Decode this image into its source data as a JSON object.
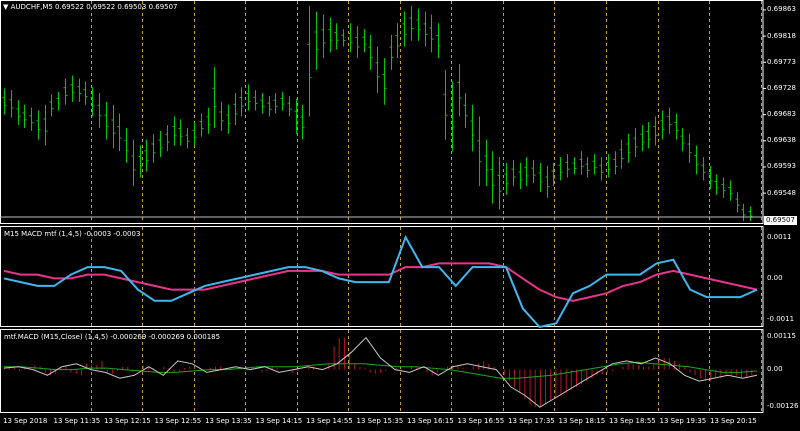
{
  "main_panel": {
    "title_arrow": "▼",
    "title": "AUDCHF,M5  0.69522 0.69522 0.69503 0.69507",
    "price_ticks": [
      "0.69863",
      "0.69818",
      "0.69773",
      "0.69728",
      "0.69683",
      "0.69638",
      "0.69593",
      "0.69548"
    ],
    "current_price": "0.69507",
    "current_price_value": 0.69507,
    "y_range": [
      0.69495,
      0.6988
    ],
    "candle_color": "#00c800",
    "candles_hl": [
      [
        0.69728,
        0.69683
      ],
      [
        0.69725,
        0.69678
      ],
      [
        0.69708,
        0.69665
      ],
      [
        0.697,
        0.6966
      ],
      [
        0.69695,
        0.69655
      ],
      [
        0.6969,
        0.6964
      ],
      [
        0.697,
        0.6963
      ],
      [
        0.69718,
        0.6968
      ],
      [
        0.69722,
        0.6969
      ],
      [
        0.69745,
        0.697
      ],
      [
        0.6975,
        0.69705
      ],
      [
        0.69745,
        0.69705
      ],
      [
        0.6974,
        0.697
      ],
      [
        0.6973,
        0.6968
      ],
      [
        0.6972,
        0.6966
      ],
      [
        0.69705,
        0.6964
      ],
      [
        0.697,
        0.69625
      ],
      [
        0.69685,
        0.6962
      ],
      [
        0.6966,
        0.696
      ],
      [
        0.6964,
        0.6956
      ],
      [
        0.6963,
        0.69575
      ],
      [
        0.6964,
        0.69585
      ],
      [
        0.6965,
        0.696
      ],
      [
        0.69655,
        0.6961
      ],
      [
        0.69665,
        0.6962
      ],
      [
        0.6968,
        0.6963
      ],
      [
        0.69675,
        0.6963
      ],
      [
        0.6966,
        0.69625
      ],
      [
        0.6967,
        0.6963
      ],
      [
        0.69685,
        0.69645
      ],
      [
        0.69695,
        0.6965
      ],
      [
        0.69765,
        0.6966
      ],
      [
        0.69705,
        0.69655
      ],
      [
        0.697,
        0.6965
      ],
      [
        0.6972,
        0.69665
      ],
      [
        0.6973,
        0.6968
      ],
      [
        0.69735,
        0.6969
      ],
      [
        0.69725,
        0.6969
      ],
      [
        0.6972,
        0.69685
      ],
      [
        0.69715,
        0.6968
      ],
      [
        0.6972,
        0.69685
      ],
      [
        0.69722,
        0.6969
      ],
      [
        0.69715,
        0.6968
      ],
      [
        0.6971,
        0.6965
      ],
      [
        0.697,
        0.6964
      ],
      [
        0.6987,
        0.6968
      ],
      [
        0.6986,
        0.6976
      ],
      [
        0.69855,
        0.6978
      ],
      [
        0.6985,
        0.6979
      ],
      [
        0.6984,
        0.69795
      ],
      [
        0.6983,
        0.698
      ],
      [
        0.6984,
        0.6979
      ],
      [
        0.69835,
        0.6978
      ],
      [
        0.6983,
        0.6979
      ],
      [
        0.6982,
        0.6976
      ],
      [
        0.698,
        0.6972
      ],
      [
        0.6978,
        0.697
      ],
      [
        0.6982,
        0.6976
      ],
      [
        0.6984,
        0.6978
      ],
      [
        0.6986,
        0.698
      ],
      [
        0.6987,
        0.6981
      ],
      [
        0.69865,
        0.6981
      ],
      [
        0.6986,
        0.698
      ],
      [
        0.69855,
        0.6979
      ],
      [
        0.6984,
        0.6978
      ],
      [
        0.6976,
        0.6964
      ],
      [
        0.6974,
        0.6962
      ],
      [
        0.6977,
        0.6968
      ],
      [
        0.6972,
        0.6966
      ],
      [
        0.697,
        0.6962
      ],
      [
        0.6968,
        0.6956
      ],
      [
        0.6964,
        0.6956
      ],
      [
        0.6962,
        0.6953
      ],
      [
        0.6961,
        0.6952
      ],
      [
        0.696,
        0.69545
      ],
      [
        0.69605,
        0.6956
      ],
      [
        0.696,
        0.69555
      ],
      [
        0.6961,
        0.6956
      ],
      [
        0.69605,
        0.69565
      ],
      [
        0.696,
        0.6955
      ],
      [
        0.69595,
        0.6954
      ],
      [
        0.696,
        0.6956
      ],
      [
        0.6961,
        0.6957
      ],
      [
        0.69615,
        0.69575
      ],
      [
        0.6961,
        0.6958
      ],
      [
        0.6962,
        0.6958
      ],
      [
        0.6961,
        0.69575
      ],
      [
        0.69615,
        0.6958
      ],
      [
        0.6961,
        0.6957
      ],
      [
        0.69615,
        0.69575
      ],
      [
        0.6962,
        0.6958
      ],
      [
        0.6964,
        0.6959
      ],
      [
        0.6965,
        0.696
      ],
      [
        0.6966,
        0.6961
      ],
      [
        0.69665,
        0.6962
      ],
      [
        0.6967,
        0.69625
      ],
      [
        0.6968,
        0.6963
      ],
      [
        0.6969,
        0.6964
      ],
      [
        0.69695,
        0.6965
      ],
      [
        0.69685,
        0.6964
      ],
      [
        0.6966,
        0.6962
      ],
      [
        0.6965,
        0.696
      ],
      [
        0.6963,
        0.6958
      ],
      [
        0.6961,
        0.6957
      ],
      [
        0.69595,
        0.69555
      ],
      [
        0.6958,
        0.69545
      ],
      [
        0.69575,
        0.6954
      ],
      [
        0.6957,
        0.69535
      ],
      [
        0.6955,
        0.69515
      ],
      [
        0.6953,
        0.695
      ],
      [
        0.69525,
        0.695
      ]
    ]
  },
  "macd_panel": {
    "title": "M15 MACD mtf (1,4,5) -0.0003 -0.0003",
    "ticks": [
      "0.0011",
      "0.00",
      "-0.0011"
    ],
    "y_range": [
      -0.0013,
      0.0014
    ],
    "macd_color": "#3fb8f0",
    "signal_color": "#e8358c",
    "macd_line": [
      0.0,
      -0.0001,
      -0.0002,
      -0.0002,
      0.0001,
      0.0003,
      0.0003,
      0.0002,
      -0.0003,
      -0.0006,
      -0.0006,
      -0.0004,
      -0.0002,
      -0.0001,
      0.0,
      0.0001,
      0.0002,
      0.0003,
      0.0003,
      0.0002,
      0.0,
      -0.0001,
      -0.0001,
      -0.0001,
      0.0011,
      0.0003,
      0.0003,
      -0.0002,
      0.0003,
      0.0003,
      0.0003,
      -0.0008,
      -0.0013,
      -0.0012,
      -0.0004,
      -0.0002,
      0.0001,
      0.0001,
      0.0001,
      0.0004,
      0.0005,
      -0.0003,
      -0.0005,
      -0.0005,
      -0.0005,
      -0.0003
    ],
    "signal_line": [
      0.0002,
      0.0001,
      0.0001,
      0.0,
      0.0,
      0.0001,
      0.0001,
      0.0,
      -0.0001,
      -0.0002,
      -0.0003,
      -0.0003,
      -0.0003,
      -0.0002,
      -0.0001,
      0.0,
      0.0001,
      0.0002,
      0.0002,
      0.0002,
      0.0001,
      0.0001,
      0.0001,
      0.0001,
      0.0003,
      0.0003,
      0.0004,
      0.0004,
      0.0004,
      0.0004,
      0.0003,
      0.0,
      -0.0003,
      -0.0005,
      -0.0006,
      -0.0005,
      -0.0004,
      -0.0002,
      -0.0001,
      0.0001,
      0.0002,
      0.0001,
      0.0,
      -0.0001,
      -0.0002,
      -0.0003
    ]
  },
  "mtf_panel": {
    "title": "mtf.MACD (M15,Close) (1,4,5) -0.000269 -0.000269 0.000185",
    "ticks": [
      "0.00115",
      "0.00",
      "-0.00126"
    ],
    "y_range": [
      -0.0015,
      0.0014
    ],
    "hist_color": "#c0102a",
    "line1_color": "#c8c8c8",
    "line2_color": "#1aaa1a",
    "histogram": [
      5e-05,
      8e-05,
      0.0001,
      -5e-05,
      3e-05,
      0.0001,
      0.00015,
      0.0001,
      -0.0001,
      -0.0002,
      -0.00015,
      5e-05,
      0.0001,
      -0.0001,
      -0.00015,
      -0.0002,
      0.0002,
      0.0002,
      0.00015,
      0.0003,
      -0.0001,
      -0.00015,
      -5e-05,
      0.0001,
      0.0001,
      -0.0001,
      0.0,
      0.00015,
      0.0001,
      5e-05,
      0.0,
      0.0001,
      5e-05,
      -0.0001,
      -5e-05,
      5e-05,
      0.0001,
      0.0001,
      5e-05,
      0.0,
      5e-05,
      0.0001,
      0.0001,
      5e-05,
      0.0,
      0.0,
      5e-05,
      0.0001,
      5e-05,
      0.0,
      -0.0001,
      -5e-05,
      0.0001,
      5e-05,
      0.0,
      0.0,
      -0.0001,
      -5e-05,
      0.0,
      5e-05,
      0.0001,
      5e-05,
      0.0,
      0.0002,
      0.0008,
      0.0011,
      0.0011,
      0.0006,
      0.0002,
      0.0001,
      5e-05,
      -0.0001,
      -0.00015,
      -0.0001,
      -5e-05,
      0.0,
      5e-05,
      -5e-05,
      0.0,
      0.0001,
      5e-05,
      0.0,
      -0.0001,
      -0.0002,
      -0.0001,
      0.0,
      0.0001,
      0.00015,
      0.0001,
      5e-05,
      0.0,
      0.0001,
      0.0002,
      0.0003,
      0.0002,
      0.0001,
      0.0,
      -0.0002,
      -0.0004,
      -0.0006,
      -0.0008,
      -0.001,
      -0.0012,
      -0.0013,
      -0.0013,
      -0.0012,
      -0.0011,
      -0.001,
      -0.0009,
      -0.0008,
      -0.0007,
      -0.0006,
      -0.0005,
      -0.0004,
      -0.0003,
      -0.0002,
      -0.00015,
      -0.0001,
      -5e-05,
      0.0,
      0.0001,
      0.0002,
      0.0002,
      0.00015,
      0.0001,
      0.0001,
      0.0002,
      0.0003,
      0.0004,
      0.0004,
      0.0003,
      0.0002,
      0.0001,
      -0.0001,
      -0.0002,
      -0.0003,
      -0.0004,
      -0.0004,
      -0.0003,
      -0.0003,
      -0.0002,
      -0.0002,
      -0.0002,
      -0.0003,
      -0.0003,
      -0.0002
    ],
    "line1": [
      5e-05,
      0.0001,
      0.0,
      -0.0002,
      0.0001,
      0.0002,
      0.0,
      -0.0001,
      -0.0003,
      -0.0002,
      0.0001,
      -0.0002,
      0.0003,
      0.0002,
      -0.0001,
      0.0,
      0.0001,
      0.0,
      0.0001,
      -0.0001,
      0.0,
      0.0001,
      0.0,
      0.0002,
      0.0006,
      0.0011,
      0.0004,
      0.0,
      -0.0001,
      0.0001,
      -0.0002,
      0.0001,
      0.0002,
      0.0001,
      0.0,
      -0.0006,
      -0.0009,
      -0.0013,
      -0.001,
      -0.0007,
      -0.0004,
      -0.0001,
      0.0002,
      0.0003,
      0.0002,
      0.0004,
      0.0002,
      -0.0002,
      -0.0004,
      -0.0003,
      -0.0002,
      -0.0003,
      -0.0002
    ],
    "line2": [
      0.0001,
      0.0001,
      5e-05,
      0.0,
      0.0,
      5e-05,
      5e-05,
      0.0,
      -5e-05,
      -0.0001,
      -0.0001,
      -5e-05,
      0.0,
      0.0,
      5e-05,
      0.0001,
      0.0001,
      0.0001,
      0.00015,
      0.0002,
      0.0002,
      0.0002,
      0.00015,
      0.0001,
      0.0001,
      5e-05,
      0.0,
      -0.0001,
      -0.0002,
      -0.0003,
      -0.0003,
      -0.00025,
      -0.0002,
      -0.0001,
      0.0,
      0.0001,
      0.0002,
      0.00025,
      0.0002,
      0.00015,
      0.0001,
      0.0,
      -0.0001,
      -0.0001,
      -5e-05
    ]
  },
  "time_axis": {
    "labels": [
      "13 Sep 2018",
      "13 Sep 11:35",
      "13 Sep 12:15",
      "13 Sep 12:55",
      "13 Sep 13:35",
      "13 Sep 14:15",
      "13 Sep 14:55",
      "13 Sep 15:35",
      "13 Sep 16:15",
      "13 Sep 16:55",
      "13 Sep 17:35",
      "13 Sep 18:15",
      "13 Sep 18:55",
      "13 Sep 19:35",
      "13 Sep 20:15"
    ]
  },
  "period_separator_color": "#c8a020"
}
